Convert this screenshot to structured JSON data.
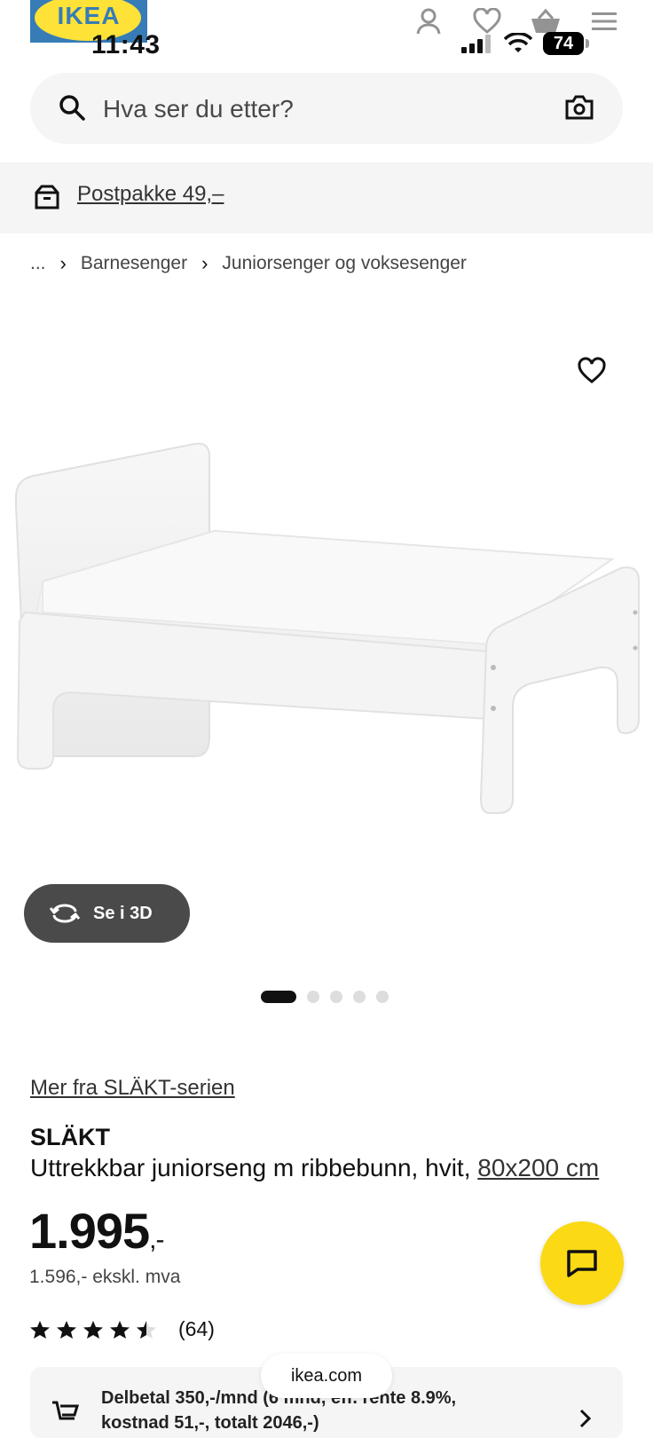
{
  "status_bar": {
    "time": "11:43",
    "battery": "74"
  },
  "header": {
    "logo_text": "IKEA"
  },
  "search": {
    "placeholder": "Hva ser du etter?"
  },
  "promo": {
    "label": "Postpakke 49,–"
  },
  "breadcrumb": {
    "ellipsis": "...",
    "items": [
      "Barnesenger",
      "Juniorsenger og voksesenger"
    ]
  },
  "gallery": {
    "view_3d_label": "Se i 3D",
    "dot_count": 5,
    "active_dot": 0
  },
  "product": {
    "series_link": "Mer fra SLÄKT-serien",
    "name": "SLÄKT",
    "description": "Uttrekkbar juniorseng m ribbebunn, hvit,",
    "size": "80x200 cm",
    "price": "1.995",
    "price_suffix": ",-",
    "price_ex_vat": "1.596,- ekskl. mva",
    "rating": 4.5,
    "review_count": "(64)"
  },
  "finance": {
    "line1": "Delbetal 350,-/mnd (6 mnd, eff. rente 8.9%,",
    "line2": "kostnad 51,-, totalt 2046,-)"
  },
  "browser": {
    "domain": "ikea.com"
  },
  "colors": {
    "brand_blue": "#0058a3",
    "brand_yellow": "#fbd914"
  }
}
